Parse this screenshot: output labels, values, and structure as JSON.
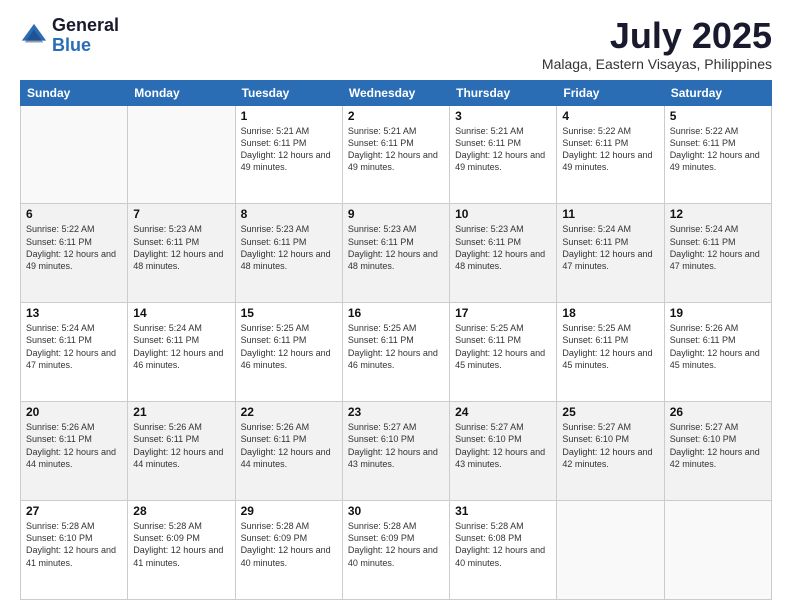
{
  "logo": {
    "general": "General",
    "blue": "Blue"
  },
  "title": "July 2025",
  "subtitle": "Malaga, Eastern Visayas, Philippines",
  "days_of_week": [
    "Sunday",
    "Monday",
    "Tuesday",
    "Wednesday",
    "Thursday",
    "Friday",
    "Saturday"
  ],
  "weeks": [
    [
      {
        "day": "",
        "info": ""
      },
      {
        "day": "",
        "info": ""
      },
      {
        "day": "1",
        "sunrise": "5:21 AM",
        "sunset": "6:11 PM",
        "daylight": "12 hours and 49 minutes."
      },
      {
        "day": "2",
        "sunrise": "5:21 AM",
        "sunset": "6:11 PM",
        "daylight": "12 hours and 49 minutes."
      },
      {
        "day": "3",
        "sunrise": "5:21 AM",
        "sunset": "6:11 PM",
        "daylight": "12 hours and 49 minutes."
      },
      {
        "day": "4",
        "sunrise": "5:22 AM",
        "sunset": "6:11 PM",
        "daylight": "12 hours and 49 minutes."
      },
      {
        "day": "5",
        "sunrise": "5:22 AM",
        "sunset": "6:11 PM",
        "daylight": "12 hours and 49 minutes."
      }
    ],
    [
      {
        "day": "6",
        "sunrise": "5:22 AM",
        "sunset": "6:11 PM",
        "daylight": "12 hours and 49 minutes."
      },
      {
        "day": "7",
        "sunrise": "5:23 AM",
        "sunset": "6:11 PM",
        "daylight": "12 hours and 48 minutes."
      },
      {
        "day": "8",
        "sunrise": "5:23 AM",
        "sunset": "6:11 PM",
        "daylight": "12 hours and 48 minutes."
      },
      {
        "day": "9",
        "sunrise": "5:23 AM",
        "sunset": "6:11 PM",
        "daylight": "12 hours and 48 minutes."
      },
      {
        "day": "10",
        "sunrise": "5:23 AM",
        "sunset": "6:11 PM",
        "daylight": "12 hours and 48 minutes."
      },
      {
        "day": "11",
        "sunrise": "5:24 AM",
        "sunset": "6:11 PM",
        "daylight": "12 hours and 47 minutes."
      },
      {
        "day": "12",
        "sunrise": "5:24 AM",
        "sunset": "6:11 PM",
        "daylight": "12 hours and 47 minutes."
      }
    ],
    [
      {
        "day": "13",
        "sunrise": "5:24 AM",
        "sunset": "6:11 PM",
        "daylight": "12 hours and 47 minutes."
      },
      {
        "day": "14",
        "sunrise": "5:24 AM",
        "sunset": "6:11 PM",
        "daylight": "12 hours and 46 minutes."
      },
      {
        "day": "15",
        "sunrise": "5:25 AM",
        "sunset": "6:11 PM",
        "daylight": "12 hours and 46 minutes."
      },
      {
        "day": "16",
        "sunrise": "5:25 AM",
        "sunset": "6:11 PM",
        "daylight": "12 hours and 46 minutes."
      },
      {
        "day": "17",
        "sunrise": "5:25 AM",
        "sunset": "6:11 PM",
        "daylight": "12 hours and 45 minutes."
      },
      {
        "day": "18",
        "sunrise": "5:25 AM",
        "sunset": "6:11 PM",
        "daylight": "12 hours and 45 minutes."
      },
      {
        "day": "19",
        "sunrise": "5:26 AM",
        "sunset": "6:11 PM",
        "daylight": "12 hours and 45 minutes."
      }
    ],
    [
      {
        "day": "20",
        "sunrise": "5:26 AM",
        "sunset": "6:11 PM",
        "daylight": "12 hours and 44 minutes."
      },
      {
        "day": "21",
        "sunrise": "5:26 AM",
        "sunset": "6:11 PM",
        "daylight": "12 hours and 44 minutes."
      },
      {
        "day": "22",
        "sunrise": "5:26 AM",
        "sunset": "6:11 PM",
        "daylight": "12 hours and 44 minutes."
      },
      {
        "day": "23",
        "sunrise": "5:27 AM",
        "sunset": "6:10 PM",
        "daylight": "12 hours and 43 minutes."
      },
      {
        "day": "24",
        "sunrise": "5:27 AM",
        "sunset": "6:10 PM",
        "daylight": "12 hours and 43 minutes."
      },
      {
        "day": "25",
        "sunrise": "5:27 AM",
        "sunset": "6:10 PM",
        "daylight": "12 hours and 42 minutes."
      },
      {
        "day": "26",
        "sunrise": "5:27 AM",
        "sunset": "6:10 PM",
        "daylight": "12 hours and 42 minutes."
      }
    ],
    [
      {
        "day": "27",
        "sunrise": "5:28 AM",
        "sunset": "6:10 PM",
        "daylight": "12 hours and 41 minutes."
      },
      {
        "day": "28",
        "sunrise": "5:28 AM",
        "sunset": "6:09 PM",
        "daylight": "12 hours and 41 minutes."
      },
      {
        "day": "29",
        "sunrise": "5:28 AM",
        "sunset": "6:09 PM",
        "daylight": "12 hours and 40 minutes."
      },
      {
        "day": "30",
        "sunrise": "5:28 AM",
        "sunset": "6:09 PM",
        "daylight": "12 hours and 40 minutes."
      },
      {
        "day": "31",
        "sunrise": "5:28 AM",
        "sunset": "6:08 PM",
        "daylight": "12 hours and 40 minutes."
      },
      {
        "day": "",
        "info": ""
      },
      {
        "day": "",
        "info": ""
      }
    ]
  ]
}
